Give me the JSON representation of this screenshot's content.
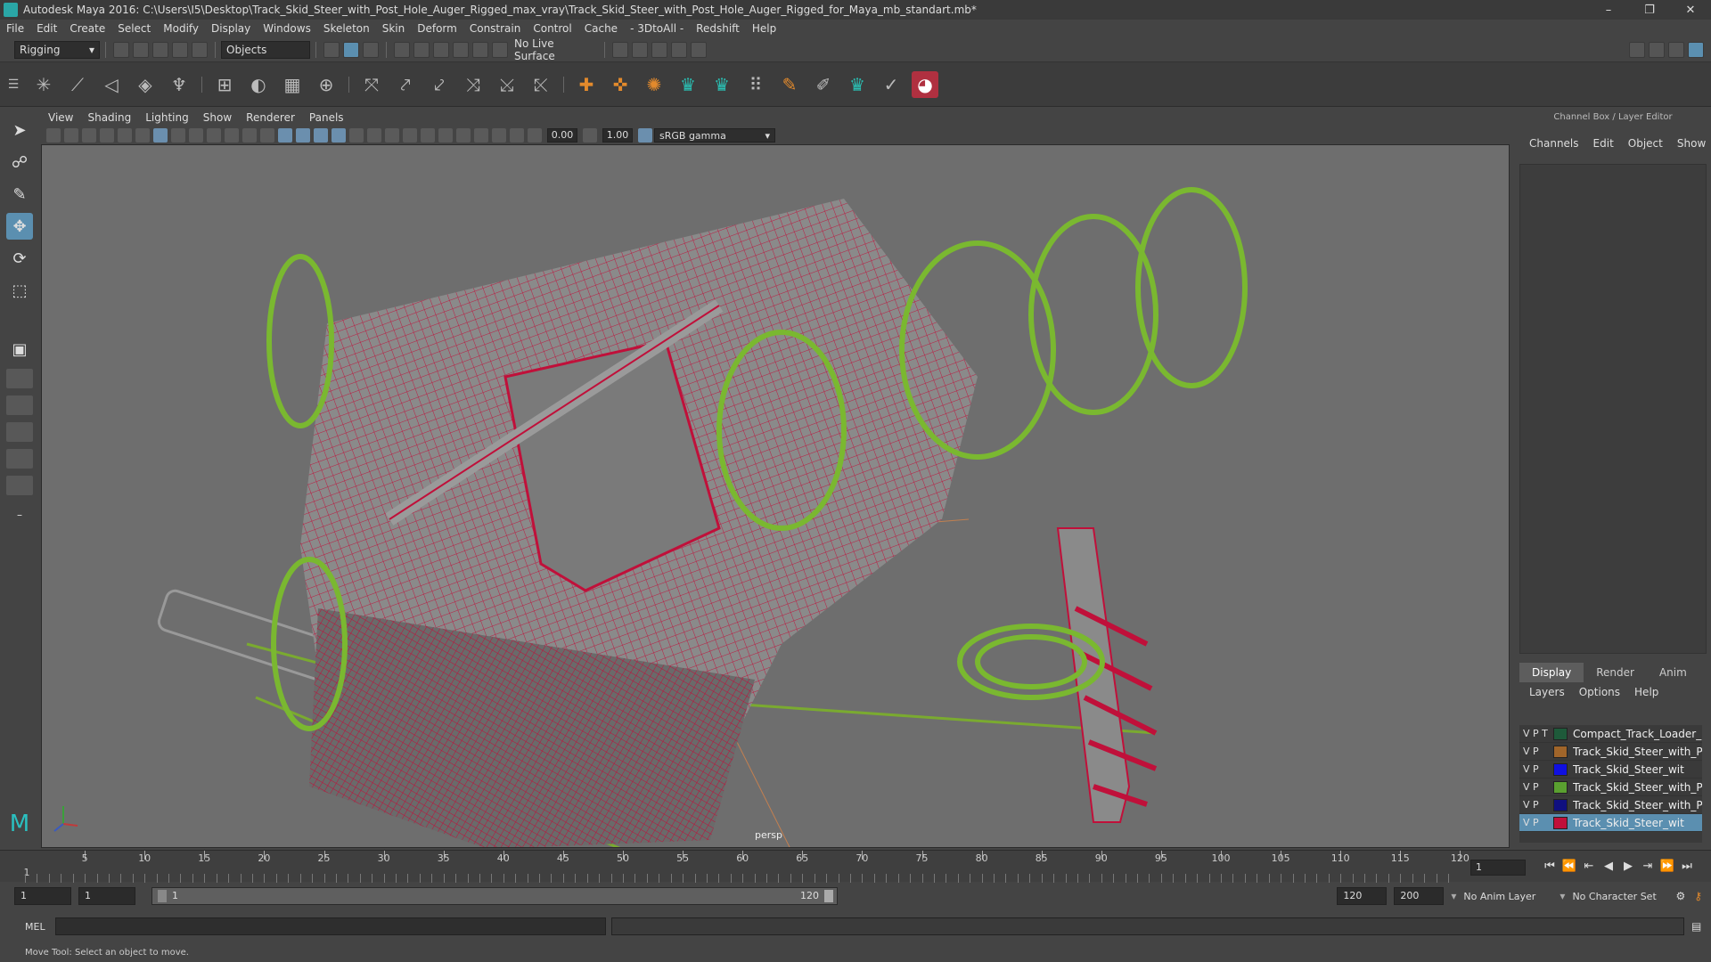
{
  "window": {
    "title": "Autodesk Maya 2016: C:\\Users\\I5\\Desktop\\Track_Skid_Steer_with_Post_Hole_Auger_Rigged_max_vray\\Track_Skid_Steer_with_Post_Hole_Auger_Rigged_for_Maya_mb_standart.mb*",
    "minimize": "–",
    "restore": "❐",
    "close": "✕"
  },
  "menubar": [
    "File",
    "Edit",
    "Create",
    "Select",
    "Modify",
    "Display",
    "Windows",
    "Skeleton",
    "Skin",
    "Deform",
    "Constrain",
    "Control",
    "Cache",
    "- 3DtoAll -",
    "Redshift",
    "Help"
  ],
  "statusline": {
    "mode": "Rigging",
    "select_mode": "Objects",
    "live_surface": "No Live Surface"
  },
  "panel": {
    "menu": [
      "View",
      "Shading",
      "Lighting",
      "Show",
      "Renderer",
      "Panels"
    ],
    "exposure": "0.00",
    "gamma": "1.00",
    "colorspace": "sRGB gamma",
    "camera": "persp"
  },
  "rightpanel": {
    "title": "Channel Box / Layer Editor",
    "menu": [
      "Channels",
      "Edit",
      "Object",
      "Show"
    ],
    "tabs": [
      "Display",
      "Render",
      "Anim"
    ],
    "layer_menu": [
      "Layers",
      "Options",
      "Help"
    ],
    "layers": [
      {
        "flags": "V P T",
        "name": "Compact_Track_Loader_Bo",
        "color": "#1e5a3a"
      },
      {
        "flags": "V P",
        "name": "Track_Skid_Steer_with_Pc",
        "color": "#a0652a"
      },
      {
        "flags": "V   P",
        "name": "Track_Skid_Steer_wit",
        "color": "#1010e0"
      },
      {
        "flags": "V P",
        "name": "Track_Skid_Steer_with_Pos",
        "color": "#5aa030"
      },
      {
        "flags": "V P",
        "name": "Track_Skid_Steer_with_Pos",
        "color": "#101080"
      },
      {
        "flags": "V P",
        "name": "Track_Skid_Steer_wit",
        "color": "#c0103a"
      }
    ]
  },
  "timeline": {
    "ticks": [
      "5",
      "10",
      "15",
      "20",
      "25",
      "30",
      "35",
      "40",
      "45",
      "50",
      "55",
      "60",
      "65",
      "70",
      "75",
      "80",
      "85",
      "90",
      "95",
      "100",
      "105",
      "110",
      "115",
      "120"
    ],
    "start_label": "1",
    "current_frame": "1"
  },
  "range": {
    "start": "1",
    "anim_start": "1",
    "slider_start": "1",
    "slider_end": "120",
    "end": "120",
    "anim_end": "200",
    "anim_layer": "No Anim Layer",
    "char_set": "No Character Set"
  },
  "cmd": {
    "label": "MEL"
  },
  "help": {
    "text": "Move Tool: Select an object to move."
  }
}
